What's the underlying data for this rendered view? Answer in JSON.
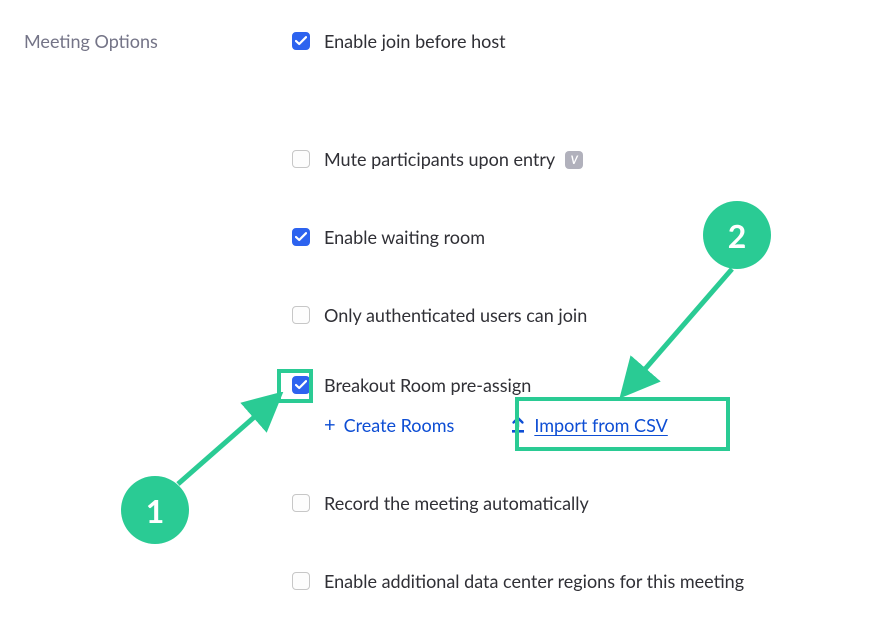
{
  "section_label": "Meeting Options",
  "options": {
    "join_before_host": {
      "label": "Enable join before host",
      "checked": true
    },
    "mute_on_entry": {
      "label": "Mute participants upon entry",
      "checked": false,
      "locked_text": "V"
    },
    "waiting_room": {
      "label": "Enable waiting room",
      "checked": true
    },
    "auth_only": {
      "label": "Only authenticated users can join",
      "checked": false
    },
    "breakout_preassign": {
      "label": "Breakout Room pre-assign",
      "checked": true
    },
    "record_auto": {
      "label": "Record the meeting automatically",
      "checked": false
    },
    "data_centers": {
      "label": "Enable additional data center regions for this meeting",
      "checked": false
    }
  },
  "actions": {
    "create_rooms": "Create Rooms",
    "import_csv": "Import from CSV",
    "plus_glyph": "+"
  },
  "annotations": {
    "step1": "1",
    "step2": "2"
  },
  "colors": {
    "accent": "#2ACB94",
    "primary": "#2D63EF",
    "link": "#0E4ED4"
  }
}
